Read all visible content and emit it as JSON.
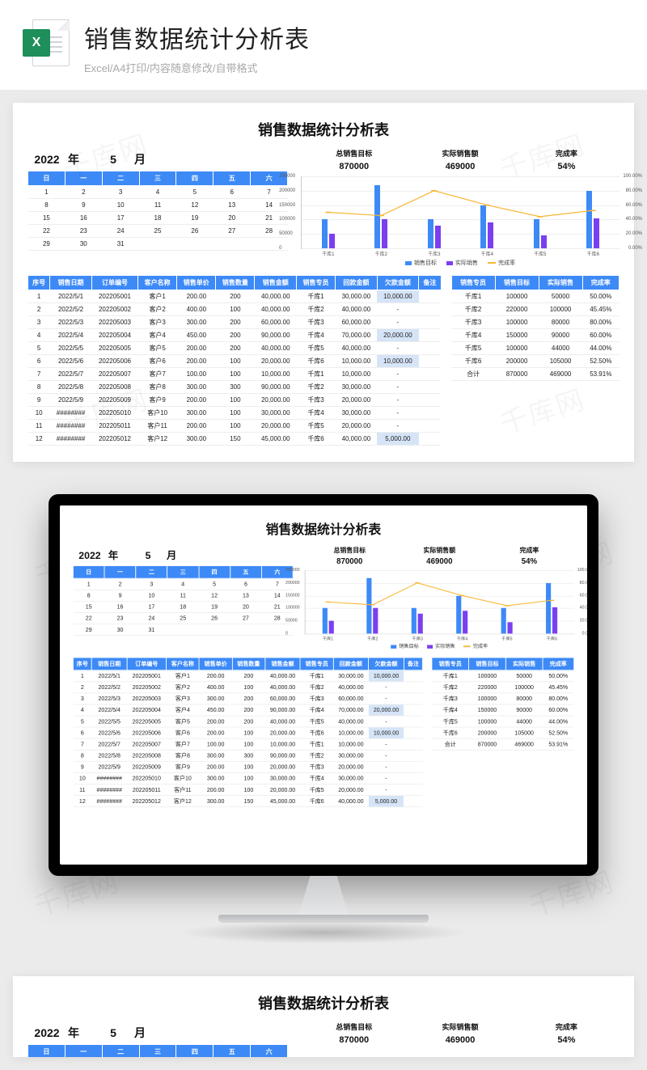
{
  "header": {
    "title": "销售数据统计分析表",
    "subtitle": "Excel/A4打印/内容随意修改/自带格式",
    "icon_letter": "X"
  },
  "watermark": "千库网",
  "doc": {
    "title": "销售数据统计分析表",
    "year": "2022",
    "year_label": "年",
    "month": "5",
    "month_label": "月"
  },
  "calendar": {
    "headers": [
      "日",
      "一",
      "二",
      "三",
      "四",
      "五",
      "六"
    ],
    "rows": [
      [
        "1",
        "2",
        "3",
        "4",
        "5",
        "6",
        "7"
      ],
      [
        "8",
        "9",
        "10",
        "11",
        "12",
        "13",
        "14"
      ],
      [
        "15",
        "16",
        "17",
        "18",
        "19",
        "20",
        "21"
      ],
      [
        "22",
        "23",
        "24",
        "25",
        "26",
        "27",
        "28"
      ],
      [
        "29",
        "30",
        "31",
        "",
        "",
        "",
        ""
      ]
    ]
  },
  "kpis": [
    {
      "label": "总销售目标",
      "value": "870000"
    },
    {
      "label": "实际销售额",
      "value": "469000"
    },
    {
      "label": "完成率",
      "value": "54%"
    }
  ],
  "chart_data": {
    "type": "bar",
    "categories": [
      "千库1",
      "千库2",
      "千库3",
      "千库4",
      "千库5",
      "千库6"
    ],
    "series": [
      {
        "name": "销售目标",
        "color": "#3d8af7",
        "values": [
          100000,
          220000,
          100000,
          150000,
          100000,
          200000
        ]
      },
      {
        "name": "实际销售",
        "color": "#7b3ff2",
        "values": [
          50000,
          100000,
          80000,
          90000,
          44000,
          105000
        ]
      }
    ],
    "line_series": {
      "name": "完成率",
      "color": "#f7b733",
      "values": [
        50.0,
        45.45,
        80.0,
        60.0,
        44.0,
        52.5
      ]
    },
    "ylim": [
      0,
      250000
    ],
    "yticks": [
      0,
      50000,
      100000,
      150000,
      200000,
      250000
    ],
    "y2lim": [
      0,
      100
    ],
    "y2ticks": [
      "0.00%",
      "20.00%",
      "40.00%",
      "60.00%",
      "80.00%",
      "100.00%"
    ]
  },
  "legend": [
    {
      "type": "sq",
      "color": "#3d8af7",
      "label": "销售目标"
    },
    {
      "type": "sq",
      "color": "#7b3ff2",
      "label": "实际销售"
    },
    {
      "type": "ln",
      "color": "#f7b733",
      "label": "完成率"
    }
  ],
  "sales_table": {
    "headers": [
      "序号",
      "销售日期",
      "订单编号",
      "客户名称",
      "销售单价",
      "销售数量",
      "销售金额",
      "销售专员",
      "回款金额",
      "欠款金额",
      "备注"
    ],
    "rows": [
      [
        "1",
        "2022/5/1",
        "202205001",
        "客户1",
        "200.00",
        "200",
        "40,000.00",
        "千库1",
        "30,000.00",
        "10,000.00",
        ""
      ],
      [
        "2",
        "2022/5/2",
        "202205002",
        "客户2",
        "400.00",
        "100",
        "40,000.00",
        "千库2",
        "40,000.00",
        "-",
        ""
      ],
      [
        "3",
        "2022/5/3",
        "202205003",
        "客户3",
        "300.00",
        "200",
        "60,000.00",
        "千库3",
        "60,000.00",
        "-",
        ""
      ],
      [
        "4",
        "2022/5/4",
        "202205004",
        "客户4",
        "450.00",
        "200",
        "90,000.00",
        "千库4",
        "70,000.00",
        "20,000.00",
        ""
      ],
      [
        "5",
        "2022/5/5",
        "202205005",
        "客户5",
        "200.00",
        "200",
        "40,000.00",
        "千库5",
        "40,000.00",
        "-",
        ""
      ],
      [
        "6",
        "2022/5/6",
        "202205006",
        "客户6",
        "200.00",
        "100",
        "20,000.00",
        "千库6",
        "10,000.00",
        "10,000.00",
        ""
      ],
      [
        "7",
        "2022/5/7",
        "202205007",
        "客户7",
        "100.00",
        "100",
        "10,000.00",
        "千库1",
        "10,000.00",
        "-",
        ""
      ],
      [
        "8",
        "2022/5/8",
        "202205008",
        "客户8",
        "300.00",
        "300",
        "90,000.00",
        "千库2",
        "30,000.00",
        "-",
        ""
      ],
      [
        "9",
        "2022/5/9",
        "202205009",
        "客户9",
        "200.00",
        "100",
        "20,000.00",
        "千库3",
        "20,000.00",
        "-",
        ""
      ],
      [
        "10",
        "########",
        "202205010",
        "客户10",
        "300.00",
        "100",
        "30,000.00",
        "千库4",
        "30,000.00",
        "-",
        ""
      ],
      [
        "11",
        "########",
        "202205011",
        "客户11",
        "200.00",
        "100",
        "20,000.00",
        "千库5",
        "20,000.00",
        "-",
        ""
      ],
      [
        "12",
        "########",
        "202205012",
        "客户12",
        "300.00",
        "150",
        "45,000.00",
        "千库6",
        "40,000.00",
        "5,000.00",
        ""
      ]
    ],
    "highlight_col": 9
  },
  "summary_table": {
    "headers": [
      "销售专员",
      "销售目标",
      "实际销售",
      "完成率"
    ],
    "rows": [
      [
        "千库1",
        "100000",
        "50000",
        "50.00%"
      ],
      [
        "千库2",
        "220000",
        "100000",
        "45.45%"
      ],
      [
        "千库3",
        "100000",
        "80000",
        "80.00%"
      ],
      [
        "千库4",
        "150000",
        "90000",
        "60.00%"
      ],
      [
        "千库5",
        "100000",
        "44000",
        "44.00%"
      ],
      [
        "千库6",
        "200000",
        "105000",
        "52.50%"
      ],
      [
        "合计",
        "870000",
        "469000",
        "53.91%"
      ]
    ]
  }
}
